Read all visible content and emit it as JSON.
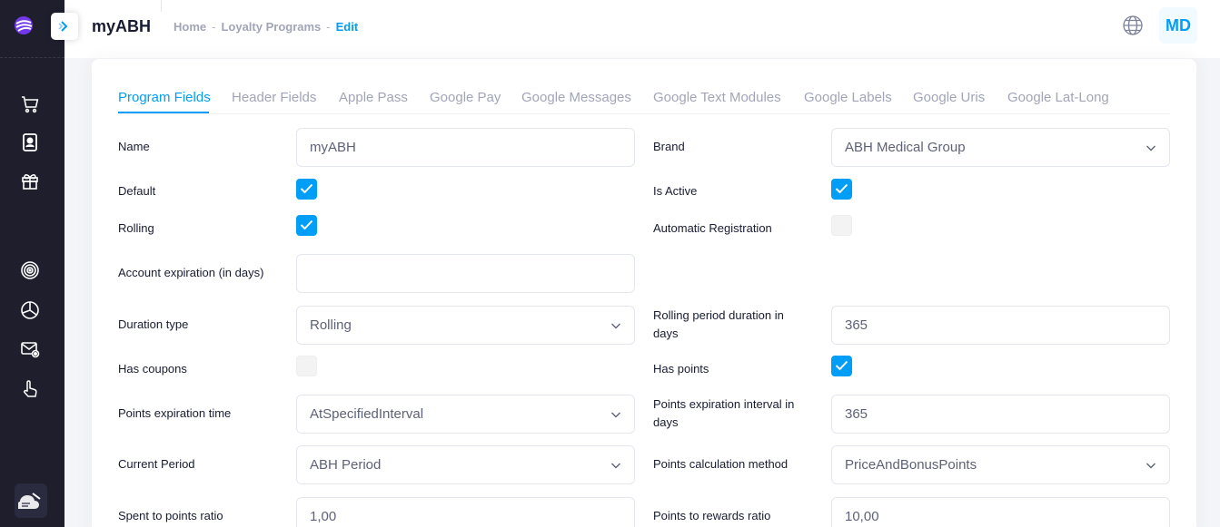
{
  "app": {
    "title": "myABH"
  },
  "breadcrumb": [
    "Home",
    "Loyalty Programs",
    "Edit"
  ],
  "header": {
    "avatar_initials": "MD",
    "language_icon": "globe-icon"
  },
  "sidebar": {
    "items": [
      {
        "icon": "cart-icon"
      },
      {
        "icon": "contact-card-icon"
      },
      {
        "icon": "gift-icon"
      },
      {
        "icon": "target-icon"
      },
      {
        "icon": "pie-chart-icon"
      },
      {
        "icon": "mail-settings-icon"
      },
      {
        "icon": "pointer-hand-icon"
      }
    ],
    "bottom_icon": "theme-toggle-icon"
  },
  "tabs": [
    "Program Fields",
    "Header Fields",
    "Apple Pass",
    "Google Pay",
    "Google Messages",
    "Google Text Modules",
    "Google Labels",
    "Google Uris",
    "Google Lat-Long"
  ],
  "active_tab": "Program Fields",
  "form": {
    "name": {
      "label": "Name",
      "value": "myABH"
    },
    "brand": {
      "label": "Brand",
      "value": "ABH Medical Group"
    },
    "default": {
      "label": "Default",
      "checked": true
    },
    "is_active": {
      "label": "Is Active",
      "checked": true
    },
    "rolling": {
      "label": "Rolling",
      "checked": true
    },
    "automatic_registration": {
      "label": "Automatic Registration",
      "checked": false
    },
    "account_expiration": {
      "label": "Account expiration (in days)",
      "value": ""
    },
    "duration_type": {
      "label": "Duration type",
      "value": "Rolling"
    },
    "rolling_period": {
      "label_line1": "Rolling period duration in",
      "label_line2": "days",
      "value": "365"
    },
    "has_coupons": {
      "label": "Has coupons",
      "checked": false
    },
    "has_points": {
      "label": "Has points",
      "checked": true
    },
    "points_expiration_time": {
      "label": "Points expiration time",
      "value": "AtSpecifiedInterval"
    },
    "points_expiration_interval": {
      "label_line1": "Points expiration interval in",
      "label_line2": "days",
      "value": "365"
    },
    "current_period": {
      "label": "Current Period",
      "value": "ABH Period"
    },
    "points_calc_method": {
      "label": "Points calculation method",
      "value": "PriceAndBonusPoints"
    },
    "spent_to_points": {
      "label": "Spent to points ratio",
      "value": "1,00"
    },
    "points_to_rewards": {
      "label": "Points to rewards ratio",
      "value": "10,00"
    }
  },
  "colors": {
    "accent": "#009ef7",
    "sidebar_bg": "#1e1e2d"
  }
}
